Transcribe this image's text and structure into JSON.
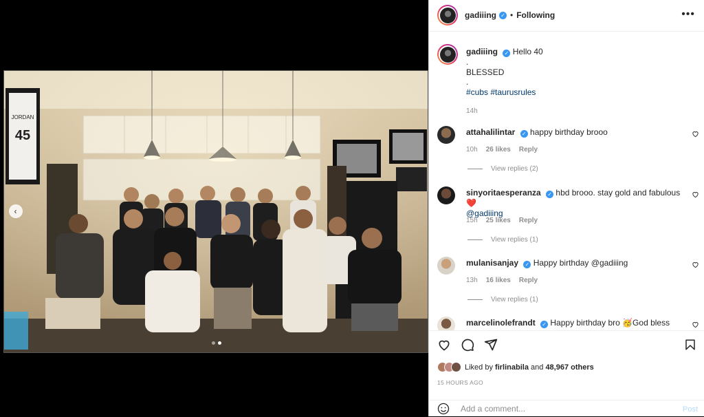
{
  "post": {
    "username": "gadiiing",
    "separator": "•",
    "follow_state": "Following",
    "more_glyph": "•••"
  },
  "photo": {
    "jersey_name": "JORDAN",
    "jersey_number": "45",
    "carousel_active_index": 1,
    "carousel_count": 2
  },
  "caption": {
    "username": "gadiiing",
    "line1": "Hello 40",
    "line2": ".",
    "line3": "BLESSED",
    "line4": ".",
    "hashtag1": "#cubs",
    "hashtag2": "#taurusrules",
    "time": "14h"
  },
  "comments": [
    {
      "username": "attahalilintar",
      "text": "happy birthday brooo",
      "time": "10h",
      "likes": "26 likes",
      "reply": "Reply",
      "view_replies": "View replies (2)"
    },
    {
      "username": "sinyoritaesperanza",
      "text": "hbd brooo. stay gold and fabulous ❤️",
      "mention": "@gadiiing",
      "time": "15h",
      "likes": "25 likes",
      "reply": "Reply",
      "view_replies": "View replies (1)"
    },
    {
      "username": "mulanisanjay",
      "text": "Happy birthday @gadiiing",
      "time": "13h",
      "likes": "16 likes",
      "reply": "Reply",
      "view_replies": "View replies (1)"
    },
    {
      "username": "marcelinolefrandt",
      "text": "Happy birthday bro 🥳God bless"
    }
  ],
  "likes": {
    "prefix": "Liked by",
    "user": "firlinabila",
    "and": "and",
    "count": "48,967 others"
  },
  "timestamp": "15 HOURS AGO",
  "composer": {
    "placeholder": "Add a comment...",
    "post_label": "Post"
  },
  "colors": {
    "link": "#00376b",
    "verified": "#3897f0",
    "muted": "#8e8e8e",
    "post_disabled": "#b3dbff"
  },
  "icons": [
    "heart-icon",
    "comment-icon",
    "share-icon",
    "bookmark-icon",
    "emoji-icon",
    "verified-icon",
    "more-icon",
    "chevron-left-icon"
  ]
}
